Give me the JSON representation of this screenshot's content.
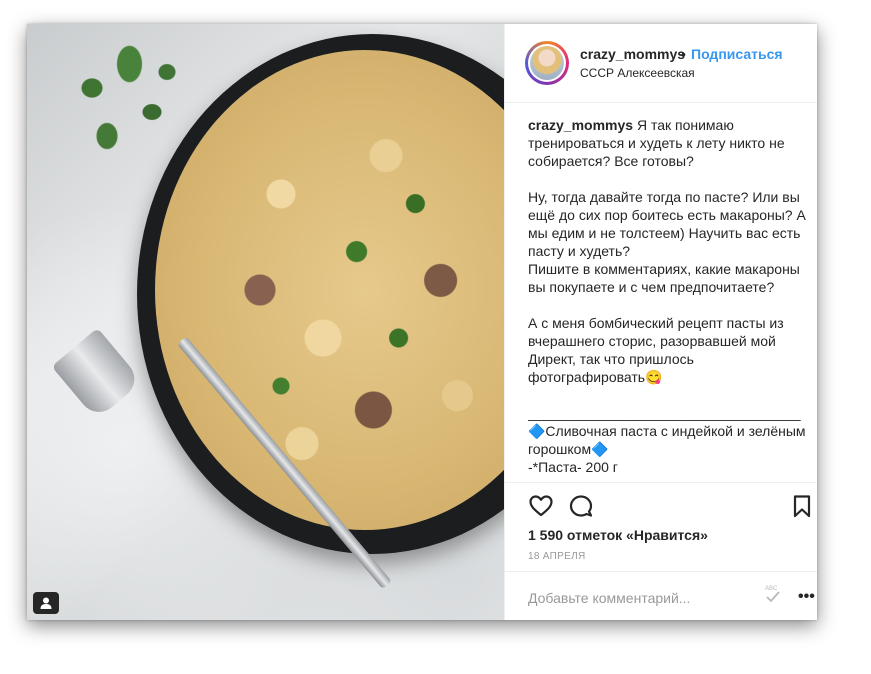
{
  "post": {
    "username": "crazy_mommys",
    "separator": "•",
    "follow_label": "Подписаться",
    "location": "СССР Алексеевская",
    "caption_user": "crazy_mommys",
    "caption_text": " Я так понимаю тренироваться и худеть к лету никто не собирается? Все готовы?\n\nНу, тогда давайте тогда по пасте? Или вы ещё до сих пор боитесь есть макароны? А мы едим и не толстеем) Научить вас есть пасту и худеть?\nПишите в комментариях, какие макароны вы покупаете и с чем предпочитаете?\n\nА с меня бомбический рецепт пасты из вчерашнего сторис, разорвавшей мой Директ, так что пришлось фотографировать😋\n\n___________________________________\n🔷Сливочная паста с индейкой и зелёным горошком🔷\n-*Паста- 200 г",
    "likes": "1 590 отметок «Нравится»",
    "date": "18 АПРЕЛЯ",
    "comment_placeholder": "Добавьте комментарий...",
    "more_label": "•••"
  },
  "icons": {
    "like": "heart-icon",
    "comment": "comment-icon",
    "save": "bookmark-icon",
    "user_tag": "user-tag-icon",
    "spellcheck": "spellcheck-icon"
  },
  "colors": {
    "link_blue": "#3897f0",
    "text": "#262626",
    "muted": "#999999",
    "border": "#efefef"
  }
}
